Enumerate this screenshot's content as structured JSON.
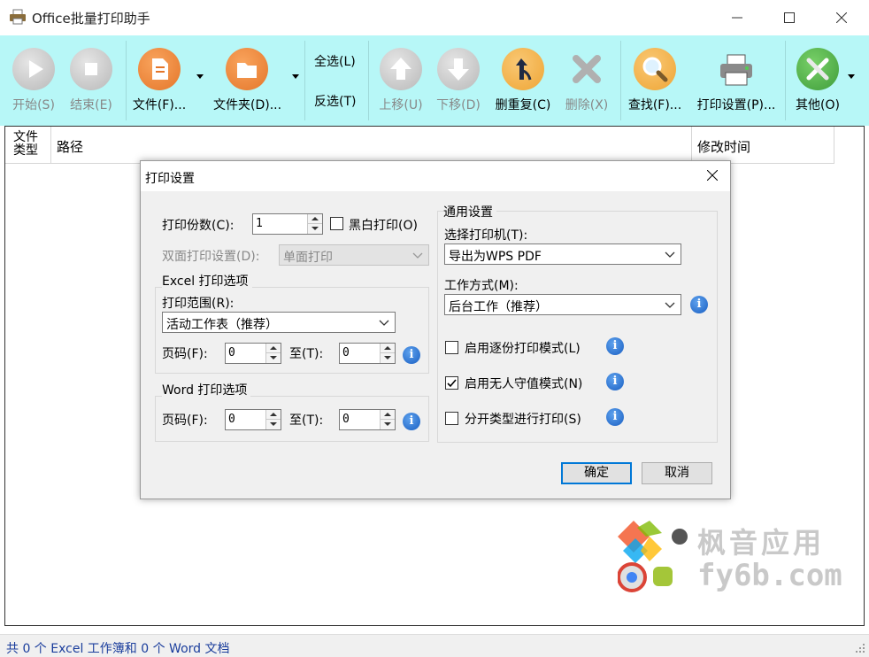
{
  "window": {
    "title": "Office批量打印助手"
  },
  "toolbar": {
    "start": "开始(S)",
    "stop": "结束(E)",
    "file": "文件(F)...",
    "folder": "文件夹(D)...",
    "select_all": "全选(L)",
    "invert": "反选(T)",
    "move_up": "上移(U)",
    "move_down": "下移(D)",
    "dedupe": "删重复(C)",
    "delete": "删除(X)",
    "find": "查找(F)...",
    "print_settings": "打印设置(P)...",
    "other": "其他(O)"
  },
  "list": {
    "col_type": "文件\n类型",
    "col_path": "路径",
    "col_modified": "修改时间"
  },
  "status": {
    "text": "共 0 个 Excel 工作簿和 0 个 Word 文档"
  },
  "dialog": {
    "title": "打印设置",
    "copies_label": "打印份数(C):",
    "copies_value": "1",
    "bw_label": "黑白打印(O)",
    "duplex_label": "双面打印设置(D):",
    "duplex_value": "单面打印",
    "excel_group": "Excel 打印选项",
    "range_label": "打印范围(R):",
    "range_value": "活动工作表（推荐）",
    "page_label": "页码(F):",
    "to_label": "至(T):",
    "excel_from": "0",
    "excel_to": "0",
    "word_group": "Word 打印选项",
    "word_page_label": "页码(F):",
    "word_to_label": "至(T):",
    "word_from": "0",
    "word_to": "0",
    "general_group": "通用设置",
    "printer_label": "选择打印机(T):",
    "printer_value": "导出为WPS PDF",
    "mode_label": "工作方式(M):",
    "mode_value": "后台工作（推荐）",
    "collate_label": "启用逐份打印模式(L)",
    "unattended_label": "启用无人守值模式(N)",
    "split_label": "分开类型进行打印(S)",
    "unattended_checked": true,
    "ok": "确定",
    "cancel": "取消"
  },
  "watermark": {
    "brand": "枫音应用",
    "domain": "fy6b.com"
  },
  "colors": {
    "toolbar_bg": "#b7f7f7",
    "status_text": "#1a3d9c",
    "accent": "#0078d7",
    "orange": "#f28a3c"
  }
}
